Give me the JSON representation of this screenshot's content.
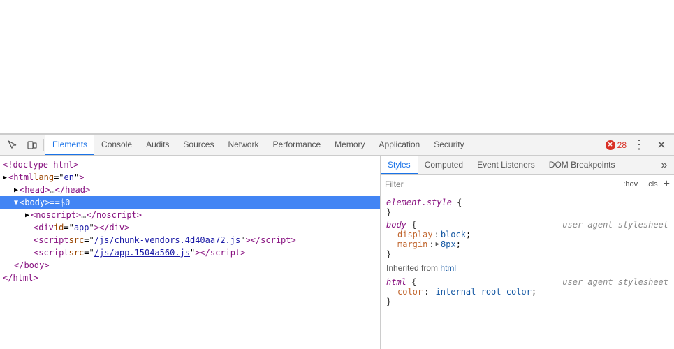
{
  "browser": {
    "bg_color": "#ffffff"
  },
  "devtools": {
    "tabs": [
      {
        "id": "elements",
        "label": "Elements",
        "active": true
      },
      {
        "id": "console",
        "label": "Console",
        "active": false
      },
      {
        "id": "audits",
        "label": "Audits",
        "active": false
      },
      {
        "id": "sources",
        "label": "Sources",
        "active": false
      },
      {
        "id": "network",
        "label": "Network",
        "active": false
      },
      {
        "id": "performance",
        "label": "Performance",
        "active": false
      },
      {
        "id": "memory",
        "label": "Memory",
        "active": false
      },
      {
        "id": "application",
        "label": "Application",
        "active": false
      },
      {
        "id": "security",
        "label": "Security",
        "active": false
      }
    ],
    "error_count": "28",
    "dom": {
      "lines": [
        {
          "id": "doctype",
          "indent": 0,
          "content": "&lt;!doctype html&gt;",
          "type": "comment"
        },
        {
          "id": "html-open",
          "indent": 0,
          "content": "",
          "type": "html-open"
        },
        {
          "id": "head",
          "indent": 1,
          "content": "",
          "type": "head"
        },
        {
          "id": "body",
          "indent": 1,
          "content": "",
          "type": "body",
          "selected": true
        },
        {
          "id": "noscript",
          "indent": 2,
          "content": "",
          "type": "noscript"
        },
        {
          "id": "div-app",
          "indent": 2,
          "content": "",
          "type": "div-app"
        },
        {
          "id": "script-vendors",
          "indent": 2,
          "content": "",
          "type": "script-vendors"
        },
        {
          "id": "script-app",
          "indent": 2,
          "content": "",
          "type": "script-app"
        },
        {
          "id": "body-close",
          "indent": 1,
          "content": "&lt;/body&gt;",
          "type": "close"
        },
        {
          "id": "html-close",
          "indent": 0,
          "content": "&lt;/html&gt;",
          "type": "close"
        }
      ]
    },
    "styles": {
      "tabs": [
        {
          "id": "styles",
          "label": "Styles",
          "active": true
        },
        {
          "id": "computed",
          "label": "Computed",
          "active": false
        },
        {
          "id": "event-listeners",
          "label": "Event Listeners",
          "active": false
        },
        {
          "id": "dom-breakpoints",
          "label": "DOM Breakpoints",
          "active": false
        }
      ],
      "filter_placeholder": "Filter",
      "hov_label": ":hov",
      "cls_label": ".cls",
      "rules": [
        {
          "selector": "element.style",
          "source": "",
          "properties": [],
          "brace_open": "{",
          "brace_close": "}"
        },
        {
          "selector": "body",
          "source": "user agent stylesheet",
          "properties": [
            {
              "name": "display",
              "value": "block"
            },
            {
              "name": "margin",
              "value": "▶ 8px"
            }
          ],
          "brace_open": "{",
          "brace_close": "}"
        }
      ],
      "inherited_label": "Inherited from",
      "inherited_from": "html",
      "html_rule": {
        "selector": "html",
        "source": "user agent stylesheet",
        "properties": [
          {
            "name": "color",
            "value": "-internal-root-color"
          }
        ]
      }
    }
  }
}
